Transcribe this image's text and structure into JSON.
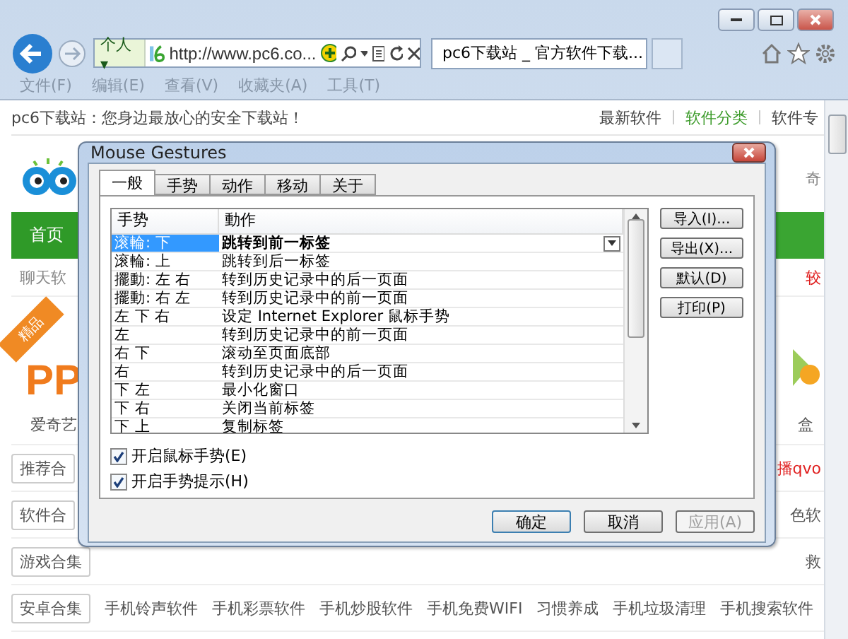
{
  "browser": {
    "search_scope": "个人",
    "scope_caret": "▾",
    "address": "http://www.pc6.co...",
    "tabs": [
      {
        "title": "pc6下载站 _ 官方软件下载...",
        "selected": true
      }
    ],
    "menu": [
      "文件(F)",
      "编辑(E)",
      "查看(V)",
      "收藏夹(A)",
      "工具(T)"
    ]
  },
  "page": {
    "tagline": "pc6下载站：您身边最放心的安全下载站！",
    "top_links": [
      {
        "label": "最新软件",
        "selected": false
      },
      {
        "label": "软件分类",
        "selected": true
      },
      {
        "label": "软件专",
        "selected": false
      }
    ],
    "tab_fragment": "奇",
    "nav_home": "首页",
    "category_left": "聊天软",
    "category_right": "较",
    "ribbon": "精品",
    "promo": "PP",
    "promo_caption": "爱奇艺",
    "promo_right": "盒",
    "rows": [
      {
        "tag": "推荐合",
        "links": [],
        "tail": "播qvo",
        "tail_hot": true
      },
      {
        "tag": "软件合",
        "links": [],
        "tail": "色软",
        "tail_hot": false
      },
      {
        "tag": "游戏合集",
        "links": [],
        "tail": "救",
        "tail_hot": false
      },
      {
        "tag": "安卓合集",
        "links": [
          "手机铃声软件",
          "手机彩票软件",
          "手机炒股软件",
          "手机免费WIFI",
          "习惯养成",
          "手机垃圾清理",
          "手机搜索软件"
        ]
      }
    ]
  },
  "dialog": {
    "title": "Mouse Gestures",
    "tabs": [
      {
        "label": "一般",
        "selected": true
      },
      {
        "label": "手势",
        "selected": false
      },
      {
        "label": "动作",
        "selected": false
      },
      {
        "label": "移动",
        "selected": false
      },
      {
        "label": "关于",
        "selected": false
      }
    ],
    "columns": [
      "手势",
      "動作"
    ],
    "rows": [
      {
        "gesture": "滚輪: 下",
        "action": "跳转到前一标签",
        "selected": true
      },
      {
        "gesture": "滚輪: 上",
        "action": "跳转到后一标签",
        "selected": false
      },
      {
        "gesture": "擺動: 左 右",
        "action": "转到历史记录中的后一页面",
        "selected": false
      },
      {
        "gesture": "擺動: 右 左",
        "action": "转到历史记录中的前一页面",
        "selected": false
      },
      {
        "gesture": "左 下 右",
        "action": "设定 Internet Explorer 鼠标手势",
        "selected": false
      },
      {
        "gesture": "左",
        "action": "转到历史记录中的前一页面",
        "selected": false
      },
      {
        "gesture": "右 下",
        "action": "滚动至页面底部",
        "selected": false
      },
      {
        "gesture": "右",
        "action": "转到历史记录中的后一页面",
        "selected": false
      },
      {
        "gesture": "下 左",
        "action": "最小化窗口",
        "selected": false
      },
      {
        "gesture": "下 右",
        "action": "关闭当前标签",
        "selected": false
      },
      {
        "gesture": "下 上",
        "action": "复制标签",
        "selected": false
      }
    ],
    "side_buttons": [
      "导入(I)...",
      "导出(X)...",
      "默认(D)",
      "打印(P)"
    ],
    "checkboxes": [
      {
        "label": "开启鼠标手势(E)",
        "checked": true
      },
      {
        "label": "开启手势提示(H)",
        "checked": true
      }
    ],
    "footer_buttons": [
      {
        "label": "确定",
        "default": true,
        "disabled": false
      },
      {
        "label": "取消",
        "default": false,
        "disabled": false
      },
      {
        "label": "应用(A)",
        "default": false,
        "disabled": true
      }
    ]
  }
}
